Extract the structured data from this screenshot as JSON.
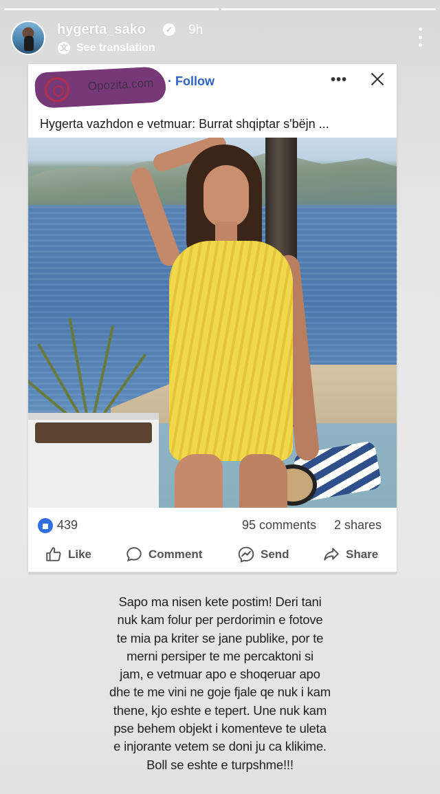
{
  "story": {
    "progress": [
      1,
      1
    ],
    "username": "hygerta_sako",
    "verified": true,
    "time": "9h",
    "see_translation": "See translation",
    "more_icon": "more-vertical-icon"
  },
  "fb_post": {
    "page_name": "Opozita.com",
    "follow_label": "· Follow",
    "headline": "Hygerta vazhdon e vetmuar: Burrat shqiptar s'bëjn ...",
    "reactions_count": "439",
    "comments": "95 comments",
    "shares": "2 shares",
    "actions": {
      "like": "Like",
      "comment": "Comment",
      "send": "Send",
      "share": "Share"
    },
    "colors": {
      "accent": "#2c64c6",
      "redaction": "#6f2e70"
    }
  },
  "caption_lines": [
    "Sapo ma nisen kete postim! Deri tani",
    "nuk kam folur per perdorimin e fotove",
    "te mia pa kriter se jane publike, por te",
    "merni persiper te me percaktoni si",
    "jam, e vetmuar apo e shoqeruar apo",
    "dhe te me vini ne goje fjale qe nuk i kam",
    "thene, kjo eshte e tepert. Une nuk kam",
    "pse behem objekt i komenteve te uleta",
    "e injorante vetem se doni ju ca klikime.",
    "Boll se eshte e turpshme!!!"
  ]
}
